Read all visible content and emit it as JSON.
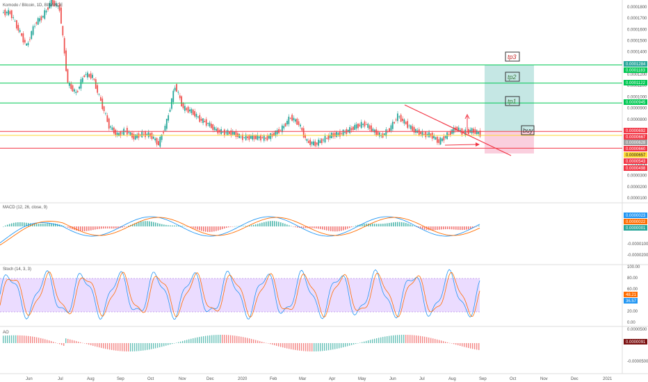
{
  "chart_data": {
    "type": "candlestick",
    "panes": {
      "price": {
        "title": "Komodo / Bitcoin, 1D, BINANCE",
        "ylim": [
          0.0,
          1.9e-05
        ],
        "y_ticks": [
          "0.0001800",
          "0.0001700",
          "0.0001600",
          "0.0001500",
          "0.0001400",
          "0.0001300",
          "0.0001200",
          "0.0001100",
          "0.0001000",
          "0.0000900",
          "0.0000800",
          "0.0000700",
          "0.0000400",
          "0.0000300",
          "0.0000200",
          "0.0000100"
        ],
        "price_tags": [
          {
            "text": "0.0001284",
            "color": "#26a69a"
          },
          {
            "text": "0.0001183",
            "color": "#00c853"
          },
          {
            "text": "0.0001122",
            "color": "#00c853"
          },
          {
            "text": "0.0000945",
            "color": "#00c853"
          },
          {
            "text": "0.0000692",
            "color": "#f23645"
          },
          {
            "text": "0.0000667",
            "color": "#f23645"
          },
          {
            "text": "0.0000628",
            "color": "#9e9e9e"
          },
          {
            "text": "0.0000660",
            "color": "#f23645"
          },
          {
            "text": "0.0000657",
            "color": "#fdd835"
          },
          {
            "text": "0.0000543",
            "color": "#f23645"
          },
          {
            "text": "0.0000498",
            "color": "#f23645"
          }
        ],
        "horizontal_lines": [
          {
            "value": 0.0001284,
            "color": "#00c853"
          },
          {
            "value": 0.0001122,
            "color": "#00c853"
          },
          {
            "value": 9.45e-05,
            "color": "#00c853"
          },
          {
            "value": 6.92e-05,
            "color": "#f23645"
          },
          {
            "value": 6.57e-05,
            "color": "#fdd835"
          },
          {
            "value": 5.43e-05,
            "color": "#f23645"
          }
        ],
        "annotations": [
          "tp3",
          "tp2",
          "tp1",
          "buy"
        ],
        "closes": [
          0.000175,
          0.00016,
          0.000145,
          0.000165,
          0.000172,
          0.000185,
          0.000179,
          0.000112,
          0.000103,
          0.00012,
          0.000118,
          9.6e-05,
          7.4e-05,
          6.6e-05,
          7e-05,
          6.4e-05,
          6.7e-05,
          6.6e-05,
          5.8e-05,
          7.8e-05,
          0.00011,
          9e-05,
          8.7e-05,
          8e-05,
          7.6e-05,
          7e-05,
          6.8e-05,
          6.8e-05,
          6.4e-05,
          6.4e-05,
          6.4e-05,
          6.3e-05,
          6.7e-05,
          7.2e-05,
          8.2e-05,
          7.6e-05,
          6e-05,
          5.8e-05,
          6.2e-05,
          6.6e-05,
          6.7e-05,
          7e-05,
          7.4e-05,
          7.6e-05,
          7e-05,
          6.5e-05,
          7.1e-05,
          8.3e-05,
          7.6e-05,
          7e-05,
          6.7e-05,
          6.6e-05,
          6e-05,
          6.6e-05,
          7.2e-05,
          6.8e-05,
          7e-05,
          6.7e-05
        ],
        "price_scale_visible": true
      },
      "macd": {
        "title": "MACD (12, 26, close, 9)",
        "y_ticks": [
          "-0.0000100",
          "-0.0000200"
        ],
        "value_tags": [
          {
            "text": "0.0000023",
            "color": "#2196f3"
          },
          {
            "text": "0.0000022",
            "color": "#ff6d00"
          },
          {
            "text": "0.0000001",
            "color": "#26a69a"
          }
        ]
      },
      "stoch": {
        "title": "Stoch (14, 3, 3)",
        "y_ticks": [
          "100.00",
          "80.00",
          "60.00",
          "40.00",
          "20.00",
          "0.00"
        ],
        "value_tags": [
          {
            "text": "48.21",
            "color": "#ff6d00"
          },
          {
            "text": "36.57",
            "color": "#2196f3"
          }
        ],
        "band": [
          20,
          80
        ]
      },
      "ao": {
        "title": "AO",
        "y_ticks": [
          "0.0000500",
          "-0.0000500"
        ],
        "value_tags": [
          {
            "text": "0.0000091",
            "color": "#7b1010"
          }
        ]
      }
    },
    "x_tick_labels": [
      "Jun",
      "Jul",
      "Aug",
      "Sep",
      "Oct",
      "Nov",
      "Dec",
      "2020",
      "Feb",
      "Mar",
      "Apr",
      "May",
      "Jun",
      "Jul",
      "Aug",
      "Sep",
      "Oct",
      "Nov",
      "Dec",
      "2021"
    ],
    "colors": {
      "up": "#26a69a",
      "down": "#ef5350",
      "macd": "#2196f3",
      "signal": "#ff6d00",
      "stoch_band": "#d4b3ff"
    }
  }
}
